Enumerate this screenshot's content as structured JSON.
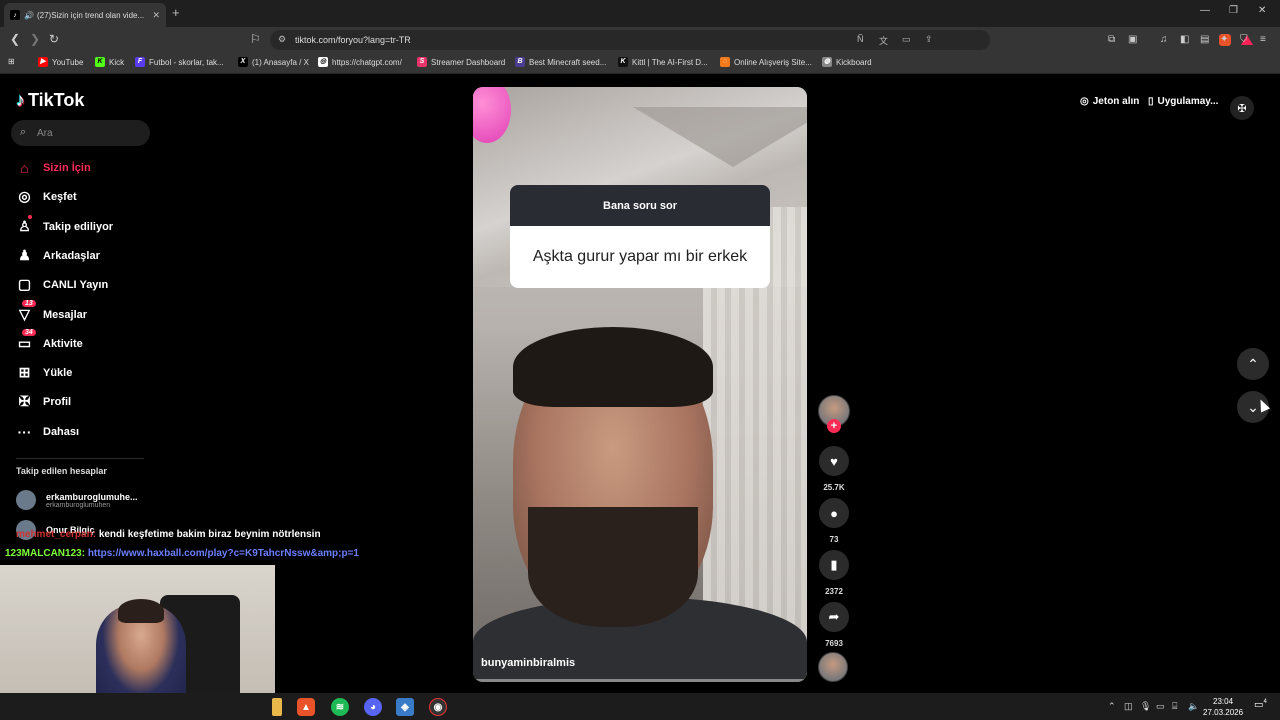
{
  "browser": {
    "tab_title": "(27)Sizin için trend olan vide...",
    "url": "tiktok.com/foryou?lang=tr-TR",
    "bookmarks": [
      {
        "label": "YouTube",
        "color": "#ff0000",
        "glyph": "▶"
      },
      {
        "label": "Kick",
        "color": "#53fc18",
        "glyph": "K"
      },
      {
        "label": "Futbol - skorlar, tak...",
        "color": "#5a3cf0",
        "glyph": "F"
      },
      {
        "label": "(1) Anasayfa / X",
        "color": "#000000",
        "glyph": "X"
      },
      {
        "label": "https://chatgpt.com/",
        "color": "#ffffff",
        "glyph": "◎"
      },
      {
        "label": "Streamer Dashboard",
        "color": "#e8336b",
        "glyph": "S"
      },
      {
        "label": "Best Minecraft seed...",
        "color": "#4a3c8f",
        "glyph": "B"
      },
      {
        "label": "Kittl | The AI-First D...",
        "color": "#111111",
        "glyph": "K"
      },
      {
        "label": "Online Alışveriş Site...",
        "color": "#f27a1a",
        "glyph": "◌"
      },
      {
        "label": "Kickboard",
        "color": "#888888",
        "glyph": "◍"
      }
    ]
  },
  "tiktok": {
    "logo": "TikTok",
    "search_placeholder": "Ara",
    "nav": [
      {
        "label": "Sizin İçin",
        "icon": "home-icon",
        "active": true
      },
      {
        "label": "Keşfet",
        "icon": "compass-icon"
      },
      {
        "label": "Takip ediliyor",
        "icon": "following-icon"
      },
      {
        "label": "Arkadaşlar",
        "icon": "friends-icon"
      },
      {
        "label": "CANLI Yayın",
        "icon": "live-icon"
      },
      {
        "label": "Mesajlar",
        "icon": "messages-icon",
        "badge": "13"
      },
      {
        "label": "Aktivite",
        "icon": "activity-icon",
        "badge": "34"
      },
      {
        "label": "Yükle",
        "icon": "upload-icon"
      },
      {
        "label": "Profil",
        "icon": "profile-icon"
      },
      {
        "label": "Dahası",
        "icon": "more-icon"
      }
    ],
    "followed_title": "Takip edilen hesaplar",
    "followed": [
      {
        "name": "erkamburoglumuhe...",
        "handle": "erkamburoglumuhen"
      },
      {
        "name": "Onur Bilgiç",
        "handle": ""
      }
    ],
    "top_buttons": {
      "coins": "Jeton alın",
      "app": "Uygulamay..."
    },
    "video": {
      "question_header": "Bana soru sor",
      "question_text": "Aşkta gurur yapar mı bir erkek",
      "username": "bunyaminbiralmis"
    },
    "actions": {
      "likes": "25.7K",
      "comments": "73",
      "saves": "2372",
      "shares": "7693"
    }
  },
  "stream_overlay": {
    "chat": [
      {
        "user": "mehmet_cerpan:",
        "message": "kendi keşfetime bakim biraz beynim nötrlensin"
      },
      {
        "user": "123MALCAN123:",
        "message": "https://www.haxball.com/play?c=K9TahcrNssw&amp;p=1"
      }
    ]
  },
  "taskbar": {
    "time": "23:04",
    "date": "27.03.2026",
    "notifications": "4"
  }
}
